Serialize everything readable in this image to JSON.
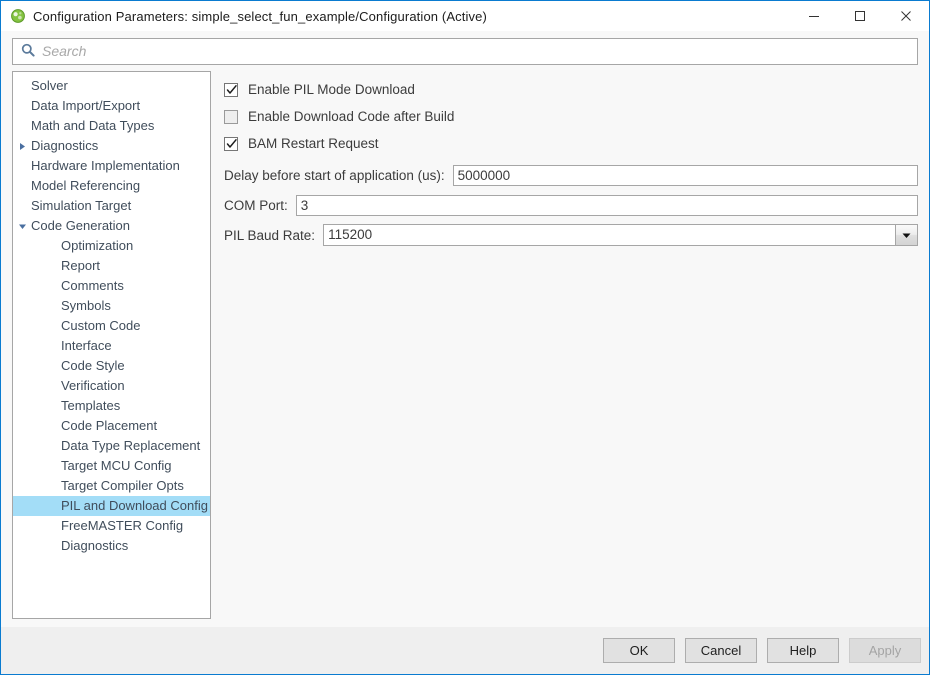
{
  "window": {
    "title": "Configuration Parameters: simple_select_fun_example/Configuration (Active)",
    "icon": "simulink-model-icon",
    "accent_border_color": "#0a7bd0",
    "controls": {
      "minimize": "minimize-icon",
      "maximize": "maximize-icon",
      "close": "close-icon"
    }
  },
  "search": {
    "icon": "search-icon",
    "placeholder": "Search",
    "value": ""
  },
  "tree": {
    "selected": "PIL and Download Config",
    "selected_color": "#a3ddf7",
    "items": [
      {
        "label": "Solver",
        "level": 0,
        "twisty": "none"
      },
      {
        "label": "Data Import/Export",
        "level": 0,
        "twisty": "none"
      },
      {
        "label": "Math and Data Types",
        "level": 0,
        "twisty": "none"
      },
      {
        "label": "Diagnostics",
        "level": 0,
        "twisty": "collapsed"
      },
      {
        "label": "Hardware Implementation",
        "level": 0,
        "twisty": "none"
      },
      {
        "label": "Model Referencing",
        "level": 0,
        "twisty": "none"
      },
      {
        "label": "Simulation Target",
        "level": 0,
        "twisty": "none"
      },
      {
        "label": "Code Generation",
        "level": 0,
        "twisty": "expanded"
      },
      {
        "label": "Optimization",
        "level": 1,
        "twisty": "none"
      },
      {
        "label": "Report",
        "level": 1,
        "twisty": "none"
      },
      {
        "label": "Comments",
        "level": 1,
        "twisty": "none"
      },
      {
        "label": "Symbols",
        "level": 1,
        "twisty": "none"
      },
      {
        "label": "Custom Code",
        "level": 1,
        "twisty": "none"
      },
      {
        "label": "Interface",
        "level": 1,
        "twisty": "none"
      },
      {
        "label": "Code Style",
        "level": 1,
        "twisty": "none"
      },
      {
        "label": "Verification",
        "level": 1,
        "twisty": "none"
      },
      {
        "label": "Templates",
        "level": 1,
        "twisty": "none"
      },
      {
        "label": "Code Placement",
        "level": 1,
        "twisty": "none"
      },
      {
        "label": "Data Type Replacement",
        "level": 1,
        "twisty": "none"
      },
      {
        "label": "Target MCU Config",
        "level": 1,
        "twisty": "none"
      },
      {
        "label": "Target Compiler Opts",
        "level": 1,
        "twisty": "none"
      },
      {
        "label": "PIL and Download Config",
        "level": 1,
        "twisty": "none",
        "selected": true
      },
      {
        "label": "FreeMASTER Config",
        "level": 1,
        "twisty": "none"
      },
      {
        "label": "Diagnostics",
        "level": 1,
        "twisty": "none"
      }
    ]
  },
  "panel": {
    "checkboxes": [
      {
        "label": "Enable PIL Mode Download",
        "checked": true
      },
      {
        "label": "Enable Download Code after Build",
        "checked": false
      },
      {
        "label": "BAM Restart Request",
        "checked": true
      }
    ],
    "fields": [
      {
        "label": "Delay before start of application (us):",
        "value": "5000000",
        "type": "text"
      },
      {
        "label": "COM Port:",
        "value": "3",
        "type": "text"
      },
      {
        "label": "PIL Baud Rate:",
        "value": "115200",
        "type": "combo"
      }
    ]
  },
  "footer": {
    "buttons": [
      {
        "label": "OK",
        "disabled": false
      },
      {
        "label": "Cancel",
        "disabled": false
      },
      {
        "label": "Help",
        "disabled": false
      },
      {
        "label": "Apply",
        "disabled": true
      }
    ]
  }
}
